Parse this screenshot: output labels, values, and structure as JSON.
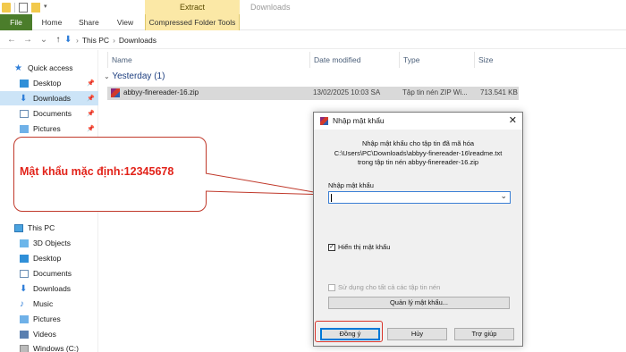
{
  "ribbon": {
    "extract_tab": "Extract",
    "window_title": "Downloads",
    "tabs": [
      "File",
      "Home",
      "Share",
      "View",
      "Compressed Folder Tools"
    ]
  },
  "address": {
    "back": "←",
    "forward": "→",
    "recent": "⌄",
    "up": "↑",
    "crumbs": [
      "This PC",
      "Downloads"
    ],
    "separator": "›"
  },
  "sidebar": {
    "quick_access": "Quick access",
    "quick_items": [
      {
        "label": "Desktop",
        "icon": "desktop-icon"
      },
      {
        "label": "Downloads",
        "icon": "downloads-icon"
      },
      {
        "label": "Documents",
        "icon": "documents-icon"
      },
      {
        "label": "Pictures",
        "icon": "pictures-icon"
      }
    ],
    "this_pc": "This PC",
    "pc_items": [
      {
        "label": "3D Objects"
      },
      {
        "label": "Desktop"
      },
      {
        "label": "Documents"
      },
      {
        "label": "Downloads"
      },
      {
        "label": "Music"
      },
      {
        "label": "Pictures"
      },
      {
        "label": "Videos"
      },
      {
        "label": "Windows (C:)"
      }
    ]
  },
  "filelist": {
    "columns": {
      "name": "Name",
      "date": "Date modified",
      "type": "Type",
      "size": "Size"
    },
    "group": "Yesterday (1)",
    "file": {
      "name": "abbyy-finereader-16.zip",
      "date": "13/02/2025 10:03 SA",
      "type": "Tập tin nén ZIP Wi...",
      "size": "713.541 KB"
    }
  },
  "callout": {
    "text": "Mật khẩu mặc định:12345678"
  },
  "dialog": {
    "title": "Nhập mật khẩu",
    "close": "✕",
    "msg1": "Nhập mật khẩu cho tập tin đã mã hóa",
    "msg2": "C:\\Users\\PC\\Downloads\\abbyy-finereader-16\\readme.txt",
    "msg3": "trong tập tin nén abbyy-finereader-16.zip",
    "password_label": "Nhập mật khẩu",
    "password_value": "",
    "show_password": "Hiển thị mật khẩu",
    "use_for_all": "Sử dụng cho tất cả các tập tin nén",
    "manage_button": "Quản lý mật khẩu...",
    "ok": "Đồng ý",
    "cancel": "Hủy",
    "help": "Trợ giúp"
  },
  "colors": {
    "accent": "#0078d7",
    "file_tab": "#4b7d2b",
    "annotation": "#e2231a",
    "tools_tab": "#fbe8a6"
  }
}
